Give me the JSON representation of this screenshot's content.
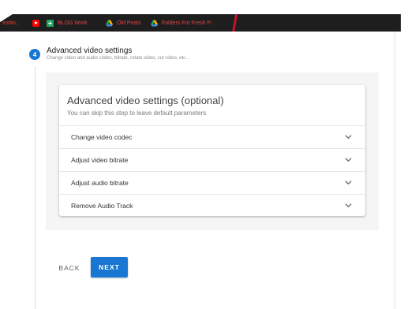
{
  "bookmarks": [
    {
      "label": "Instin...",
      "icon": "none"
    },
    {
      "label": "",
      "icon": "youtube-icon"
    },
    {
      "label": "BLOG Work",
      "icon": "sheets-icon"
    },
    {
      "label": "Old Posts",
      "icon": "drive-icon"
    },
    {
      "label": "Folders For Fresh P...",
      "icon": "drive-icon"
    }
  ],
  "step": {
    "number": "4",
    "title": "Advanced video settings",
    "subtitle": "Change video and audio codec, bitrate, rotate video, cut video, etc..."
  },
  "card": {
    "title": "Advanced video settings (optional)",
    "subtitle": "You can skip this step to leave default parameters",
    "items": [
      {
        "label": "Change video codec",
        "icon": "chevron-down-icon"
      },
      {
        "label": "Adjust video bitrate",
        "icon": "chevron-down-icon"
      },
      {
        "label": "Adjust audio bitrate",
        "icon": "chevron-down-icon"
      },
      {
        "label": "Remove Audio Track",
        "icon": "chevron-down-icon"
      }
    ]
  },
  "actions": {
    "back_label": "BACK",
    "next_label": "NEXT"
  },
  "colors": {
    "accent": "#1976d2",
    "bookmarks_bar": "#1e1e1e",
    "bookmark_text": "#e8453c",
    "panel_bg": "#f5f5f5"
  }
}
